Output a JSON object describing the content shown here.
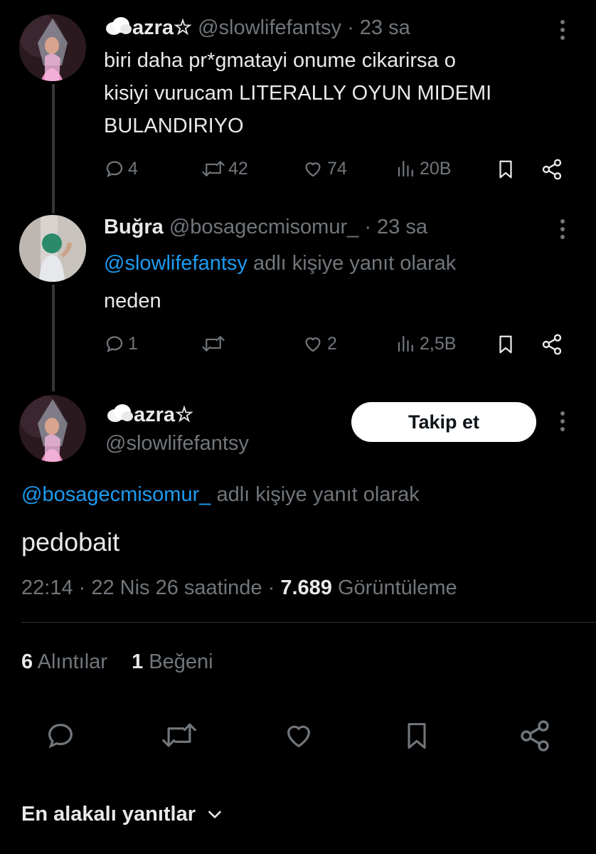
{
  "thread": [
    {
      "display_name": "azra☆",
      "handle": "@slowlifefantsy",
      "time": "· 23 sa",
      "text_lines": [
        "biri daha pr*gmatayi onume cikarirsa o",
        "kisiyi vurucam LITERALLY OYUN MIDEMI",
        "BULANDIRIYO"
      ],
      "stats": {
        "replies": "4",
        "reposts": "42",
        "likes": "74",
        "views": "20B"
      }
    },
    {
      "display_name": "Buğra",
      "handle": "@bosagecmisomur_",
      "time": "· 23 sa",
      "reply_to_handle": "@slowlifefantsy",
      "reply_to_suffix": "adlı kişiye yanıt olarak",
      "text": "neden",
      "stats": {
        "replies": "1",
        "reposts": "",
        "likes": "2",
        "views": "2,5B"
      }
    }
  ],
  "main_tweet": {
    "display_name": "azra☆",
    "handle": "@slowlifefantsy",
    "follow_label": "Takip et",
    "reply_to_handle": "@bosagecmisomur_",
    "reply_to_suffix": "adlı kişiye yanıt olarak",
    "text": "pedobait",
    "timestamp": "22:14 · 22 Nis 26 saatinde ·",
    "views_count": "7.689",
    "views_label": "Görüntüleme",
    "quotes_count": "6",
    "quotes_label": "Alıntılar",
    "likes_count": "1",
    "likes_label": "Beğeni"
  },
  "sort": {
    "label": "En alakalı yanıtlar"
  },
  "colors": {
    "background": "#000000",
    "text": "#e7e9ea",
    "muted": "#71767b",
    "link": "#1d9bf0",
    "divider": "#2f3336"
  },
  "icons": [
    "cloud-emoji-icon",
    "more-dots-icon",
    "reply-icon",
    "repost-icon",
    "like-icon",
    "views-icon",
    "bookmark-icon",
    "share-icon",
    "chevron-down-icon"
  ]
}
